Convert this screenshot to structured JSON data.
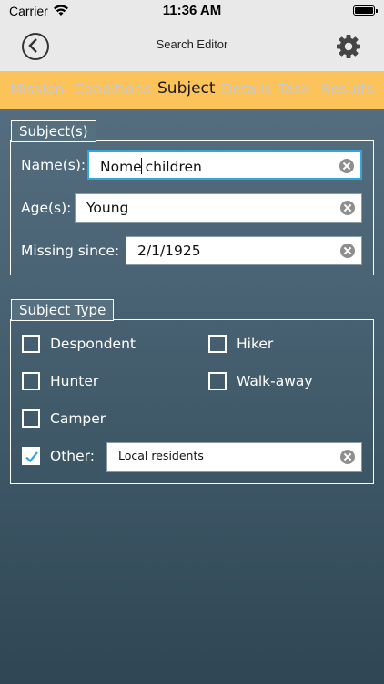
{
  "status": {
    "carrier": "Carrier",
    "time": "11:36 AM",
    "battery_level": 1.0
  },
  "nav": {
    "title": "Search Editor",
    "back_icon": "back-circle-icon",
    "settings_icon": "gear-icon"
  },
  "tabs": [
    {
      "label": "Mission",
      "active": false
    },
    {
      "label": "Conditions",
      "active": false
    },
    {
      "label": "Subject",
      "active": true
    },
    {
      "label": "Details",
      "active": false
    },
    {
      "label": "Task",
      "active": false
    },
    {
      "label": "Results",
      "active": false
    }
  ],
  "subjects": {
    "legend": "Subject(s)",
    "names_label": "Name(s):",
    "names_value_before_cursor": "Nome",
    "names_value_after_cursor": " children",
    "ages_label": "Age(s):",
    "ages_value": "Young",
    "missing_label": "Missing since:",
    "missing_value": "2/1/1925"
  },
  "subject_type": {
    "legend": "Subject Type",
    "options": [
      {
        "label": "Despondent",
        "checked": false
      },
      {
        "label": "Hiker",
        "checked": false
      },
      {
        "label": "Hunter",
        "checked": false
      },
      {
        "label": "Walk-away",
        "checked": false
      },
      {
        "label": "Camper",
        "checked": false
      },
      {
        "label": "Other:",
        "checked": true
      }
    ],
    "other_value": "Local residents"
  },
  "colors": {
    "tab_bar": "#fcc35a",
    "active_tab": "#1a1a1a",
    "inactive_tab": "#c8c8c8",
    "focus": "#33a6d9",
    "check": "#33a6d9"
  }
}
